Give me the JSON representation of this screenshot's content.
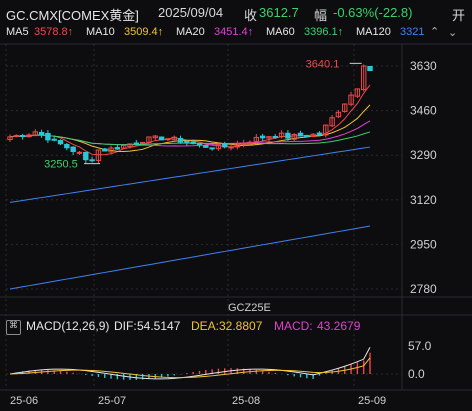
{
  "header": {
    "symbol": "GC.CMX[COMEX黄金]",
    "date": "2025/09/04",
    "close_label": "收",
    "close_value": "3612.7",
    "change_label": "幅",
    "change_value": "-0.63%(-22.8)",
    "open_label": "开"
  },
  "ma_indicators": [
    {
      "label": "MA5",
      "value": "3578.8↑",
      "color": "#f04848"
    },
    {
      "label": "MA10",
      "value": "3509.4↑",
      "color": "#f2c233"
    },
    {
      "label": "MA20",
      "value": "3451.4↑",
      "color": "#e040d0"
    },
    {
      "label": "MA60",
      "value": "3396.1↑",
      "color": "#3bd06a"
    },
    {
      "label": "MA120",
      "value": "3321",
      "color": "#3f82f0"
    }
  ],
  "price_axis": [
    "3630",
    "3460",
    "3290",
    "3120",
    "2950",
    "2780"
  ],
  "annotations": {
    "high": "3640.1",
    "low": "3250.5"
  },
  "contract_label": "GCZ25E",
  "macd": {
    "title": "MACD(12,26,9)",
    "dif_label": "DIF:",
    "dif_value": "54.5147",
    "dea_label": "DEA:",
    "dea_value": "32.8807",
    "macd_label": "MACD:",
    "macd_value": "43.2679",
    "axis": [
      "57.0",
      "0.0"
    ]
  },
  "time_axis": [
    "25-06",
    "25-07",
    "25-08",
    "25-09"
  ],
  "colors": {
    "up": "#f04848",
    "down": "#28c8d8",
    "grid": "#2a2a30",
    "background": "#0d0d10",
    "negative": "#3bd06a"
  },
  "chart_data": {
    "type": "line",
    "title": "",
    "categories": [
      "25-06",
      "25-07",
      "25-08",
      "25-09"
    ],
    "series": [
      {
        "name": "MA5",
        "values": [
          3578.8
        ]
      },
      {
        "name": "MA10",
        "values": [
          3509.4
        ]
      },
      {
        "name": "MA20",
        "values": [
          3451.4
        ]
      },
      {
        "name": "MA60",
        "values": [
          3396.1
        ]
      },
      {
        "name": "MA120",
        "values": [
          3321
        ]
      }
    ],
    "last_close": 3612.7,
    "high": 3640.1,
    "low": 3250.5,
    "ylim": [
      2780,
      3630
    ],
    "macd": {
      "dif": 54.5147,
      "dea": 32.8807,
      "macd": 43.2679,
      "ylim": [
        0,
        57
      ]
    }
  }
}
